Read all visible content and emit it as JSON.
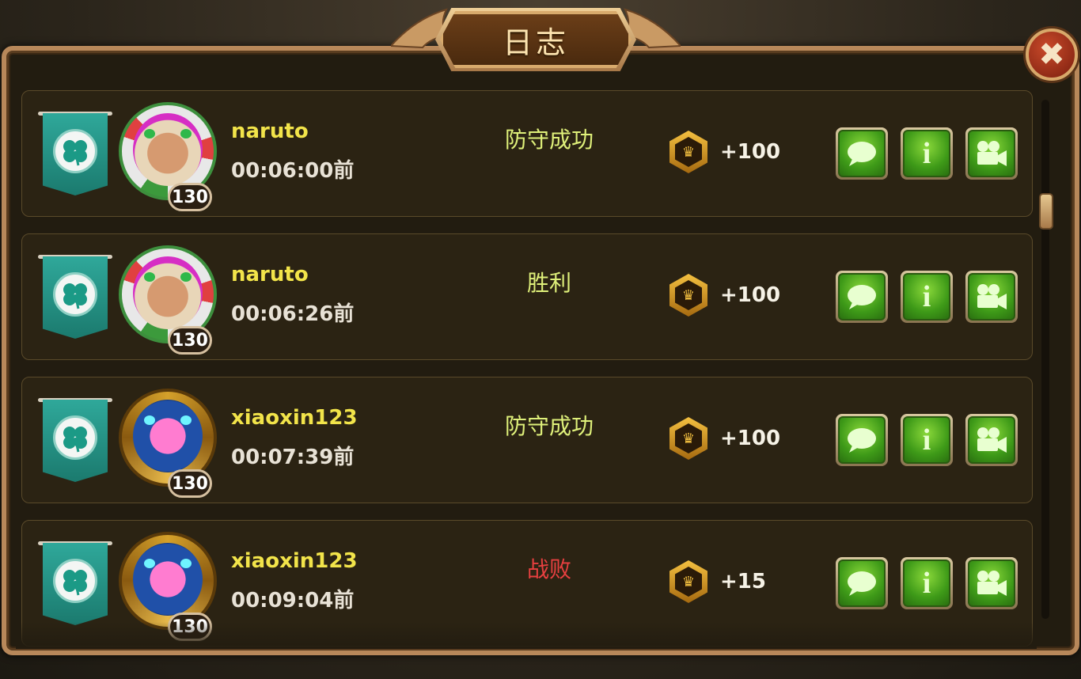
{
  "dialog": {
    "title": "日志",
    "close_label": "✖"
  },
  "log_entries": [
    {
      "username": "naruto",
      "time_ago": "00:06:00前",
      "result": "防守成功",
      "result_type": "win",
      "points": "+100",
      "level": "130",
      "avatar": "rose-girl"
    },
    {
      "username": "naruto",
      "time_ago": "00:06:26前",
      "result": "胜利",
      "result_type": "win",
      "points": "+100",
      "level": "130",
      "avatar": "rose-girl"
    },
    {
      "username": "xiaoxin123",
      "time_ago": "00:07:39前",
      "result": "防守成功",
      "result_type": "win",
      "points": "+100",
      "level": "130",
      "avatar": "pink-spirit"
    },
    {
      "username": "xiaoxin123",
      "time_ago": "00:09:04前",
      "result": "战败",
      "result_type": "lose",
      "points": "+15",
      "level": "130",
      "avatar": "pink-spirit"
    }
  ],
  "icons": {
    "guild_banner": "clover-banner-icon",
    "points_medal": "crown-medal-icon",
    "chat": "chat-bubble-icon",
    "info": "info-icon",
    "replay": "video-camera-icon"
  },
  "colors": {
    "username": "#f2e44a",
    "win": "#dff07a",
    "lose": "#e84040",
    "button_green": "#3e9a18",
    "banner_teal": "#2fa89a"
  }
}
